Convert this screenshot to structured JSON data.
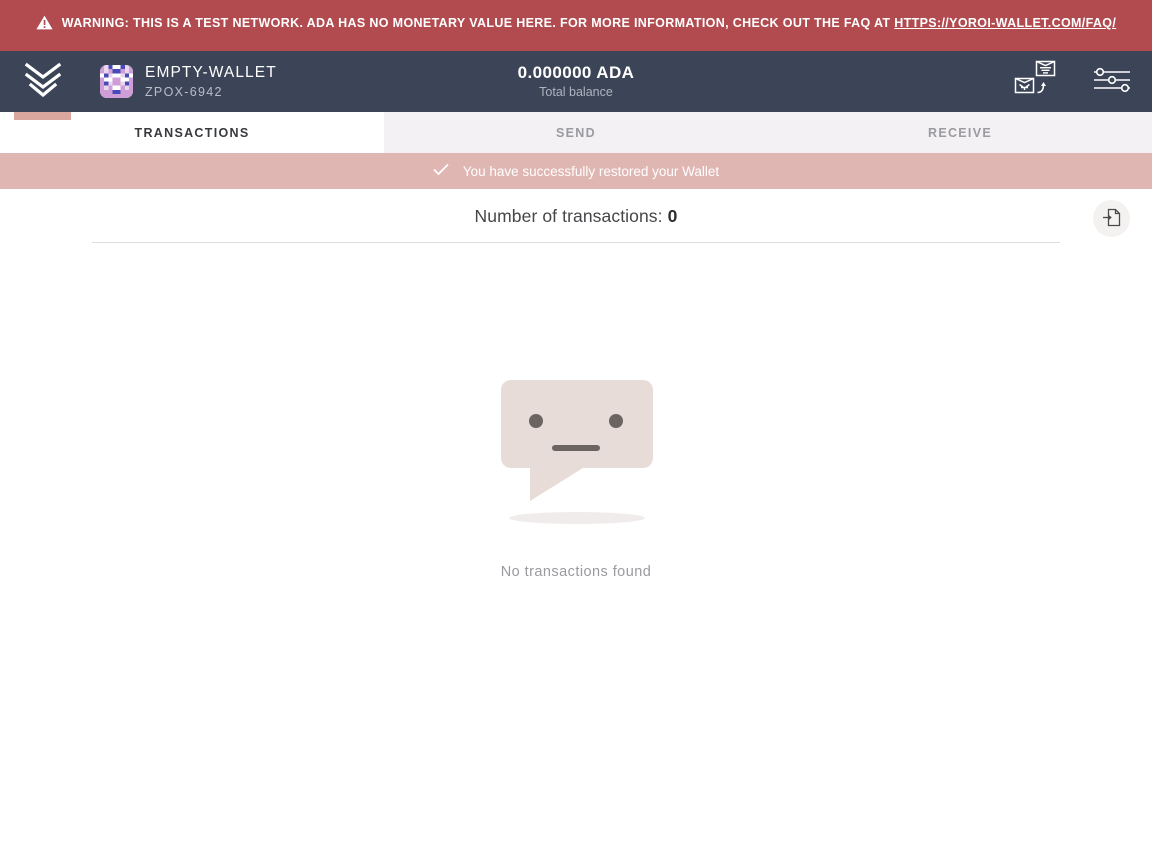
{
  "warning": {
    "icon": "warning-triangle-icon",
    "text_before_link": "WARNING: THIS IS A TEST NETWORK. ADA HAS NO MONETARY VALUE HERE. FOR MORE INFORMATION, CHECK OUT THE FAQ AT ",
    "link_label": "HTTPS://YOROI-WALLET.COM/FAQ/",
    "background_color": "#b14b4f",
    "text_color": "#ffffff"
  },
  "topbar": {
    "logo_icon": "yoroi-chevron-logo-icon",
    "wallet": {
      "avatar_icon": "wallet-identicon-avatar",
      "name": "EMPTY-WALLET",
      "plate": "ZPOX-6942"
    },
    "balance": {
      "amount": "0.000000 ADA",
      "label": "Total balance"
    },
    "actions": [
      {
        "name": "switch-wallet-icon",
        "label": "Switch wallet"
      },
      {
        "name": "settings-sliders-icon",
        "label": "Settings"
      }
    ],
    "background_color": "#3c4557",
    "indicator_color": "#d9a79d"
  },
  "tabs": [
    {
      "label": "TRANSACTIONS",
      "active": true
    },
    {
      "label": "SEND",
      "active": false
    },
    {
      "label": "RECEIVE",
      "active": false
    }
  ],
  "notification": {
    "icon": "check-icon",
    "message": "You have successfully restored your Wallet",
    "background_color": "#e0b6b2"
  },
  "transactions": {
    "count_label": "Number of transactions:",
    "count_value": "0",
    "export_button": {
      "name": "export-transactions-icon",
      "label": "Export transactions"
    },
    "empty_state": {
      "illustration": "no-transactions-face-bubble-illustration",
      "message": "No transactions found"
    }
  }
}
